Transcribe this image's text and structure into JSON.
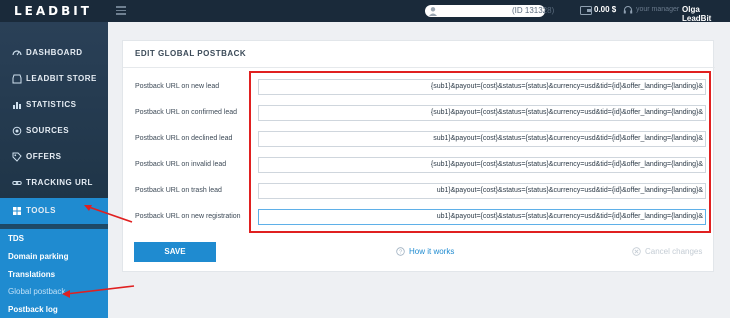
{
  "header": {
    "logo": "LEADBIT",
    "user_id": "(ID 131328)",
    "balance": "0.00 $",
    "manager_label": "your manager",
    "manager_name": "Olga LeadBit"
  },
  "sidebar": {
    "items": [
      {
        "label": "DASHBOARD",
        "icon": "gauge-icon"
      },
      {
        "label": "LEADBIT STORE",
        "icon": "store-icon"
      },
      {
        "label": "STATISTICS",
        "icon": "bar-chart-icon"
      },
      {
        "label": "SOURCES",
        "icon": "sources-icon"
      },
      {
        "label": "OFFERS",
        "icon": "offers-icon"
      },
      {
        "label": "TRACKING URL",
        "icon": "link-icon"
      },
      {
        "label": "TOOLS",
        "icon": "tools-icon"
      }
    ],
    "submenu": [
      "TDS",
      "Domain parking",
      "Translations",
      "Global postback",
      "Postback log"
    ]
  },
  "card": {
    "title": "EDIT GLOBAL POSTBACK",
    "rows": [
      {
        "label": "Postback URL on new lead",
        "value": "{sub1}&payout={cost}&status={status}&currency=usd&tid={id}&offer_landing={landing}&"
      },
      {
        "label": "Postback URL on confirmed lead",
        "value": "{sub1}&payout={cost}&status={status}&currency=usd&tid={id}&offer_landing={landing}&"
      },
      {
        "label": "Postback URL on declined lead",
        "value": "sub1}&payout={cost}&status={status}&currency=usd&tid={id}&offer_landing={landing}&"
      },
      {
        "label": "Postback URL on invalid lead",
        "value": "{sub1}&payout={cost}&status={status}&currency=usd&tid={id}&offer_landing={landing}&"
      },
      {
        "label": "Postback URL on trash lead",
        "value": "ub1}&payout={cost}&status={status}&currency=usd&tid={id}&offer_landing={landing}&"
      },
      {
        "label": "Postback URL on new registration",
        "value": "ub1}&payout={cost}&status={status}&currency=usd&tid={id}&offer_landing={landing}&"
      }
    ],
    "save_label": "SAVE",
    "how_it_works": "How it works",
    "cancel_changes": "Cancel changes"
  },
  "colors": {
    "accent": "#1f8bd0",
    "annotation": "#e02020",
    "topbar": "#1a2a3a"
  }
}
